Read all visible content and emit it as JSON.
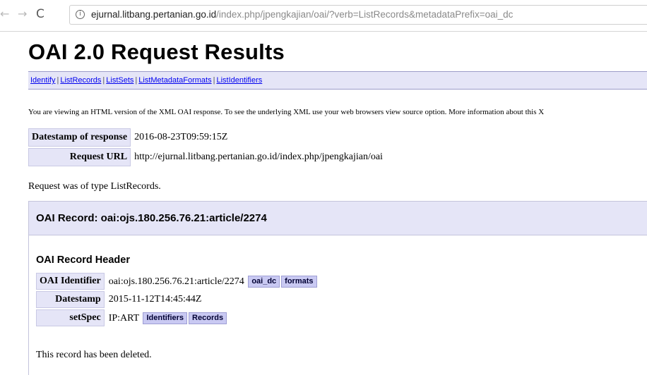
{
  "browser": {
    "url_host": "ejurnal.litbang.pertanian.go.id",
    "url_path": "/index.php/jpengkajian/oai/?verb=ListRecords&metadataPrefix=oai_dc",
    "icons": {
      "back": "back-arrow-icon",
      "forward": "forward-arrow-icon",
      "reload": "reload-icon",
      "info": "info-icon"
    }
  },
  "page": {
    "title": "OAI 2.0 Request Results",
    "menu": [
      {
        "label": "Identify"
      },
      {
        "label": "ListRecords"
      },
      {
        "label": "ListSets"
      },
      {
        "label": "ListMetadataFormats"
      },
      {
        "label": "ListIdentifiers"
      }
    ],
    "menu_separator": "|",
    "intro": "You are viewing an HTML version of the XML OAI response. To see the underlying XML use your web browsers view source option. More information about this X",
    "response": {
      "datestamp_label": "Datestamp of response",
      "datestamp_value": "2016-08-23T09:59:15Z",
      "request_url_label": "Request URL",
      "request_url_value": "http://ejurnal.litbang.pertanian.go.id/index.php/jpengkajian/oai"
    },
    "request_type": "Request was of type ListRecords."
  },
  "record": {
    "heading": "OAI Record: oai:ojs.180.256.76.21:article/2274",
    "header_title": "OAI Record Header",
    "rows": [
      {
        "label": "OAI Identifier",
        "value": "oai:ojs.180.256.76.21:article/2274",
        "buttons": [
          "oai_dc",
          "formats"
        ]
      },
      {
        "label": "Datestamp",
        "value": "2015-11-12T14:45:44Z",
        "buttons": []
      },
      {
        "label": "setSpec",
        "value": "IP:ART",
        "buttons": [
          "Identifiers",
          "Records"
        ]
      }
    ],
    "deleted_note": "This record has been deleted."
  },
  "colors": {
    "accent_bg": "#e5e5f7",
    "tag_bg": "#c9c9f2",
    "link": "#0000ee"
  }
}
